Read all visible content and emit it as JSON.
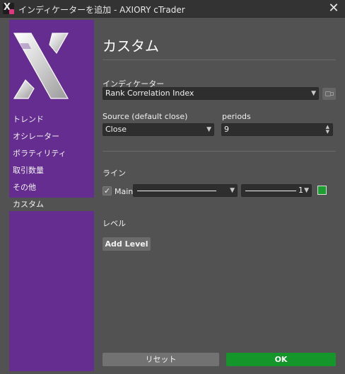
{
  "window": {
    "title": "インディケーターを追加 - AXIORY cTrader",
    "close_glyph": "✕"
  },
  "sidebar": {
    "items": [
      {
        "label": "トレンド"
      },
      {
        "label": "オシレーター"
      },
      {
        "label": "ボラティリティ"
      },
      {
        "label": "取引数量"
      },
      {
        "label": "その他"
      },
      {
        "label": "カスタム",
        "active": true
      }
    ]
  },
  "main": {
    "title": "カスタム",
    "indicator": {
      "label": "インディケーター",
      "value": "Rank Correlation Index"
    },
    "source": {
      "label": "Source (default close)",
      "value": "Close"
    },
    "periods": {
      "label": "periods",
      "value": "9"
    },
    "lines": {
      "label": "ライン",
      "main_label": "Main",
      "main_checked": true,
      "thickness": "1",
      "color": "#1e9e2e"
    },
    "levels": {
      "label": "レベル",
      "add_button": "Add Level"
    }
  },
  "footer": {
    "reset_button": "リセット",
    "ok_button": "OK"
  },
  "icons": {
    "app": "ctrader-app-icon",
    "close": "close-icon",
    "camera": "camera-icon",
    "check": "✓",
    "caret": "▼",
    "stepper_up": "▲",
    "stepper_down": "▼"
  },
  "colors": {
    "sidebar": "#652d90",
    "ok": "#15962a",
    "background": "#525252"
  }
}
